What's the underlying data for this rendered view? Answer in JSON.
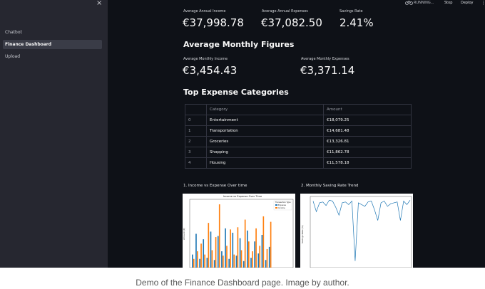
{
  "sidebar": {
    "close": "×",
    "items": [
      {
        "label": "Chatbot",
        "active": false
      },
      {
        "label": "Finance Dashboard",
        "active": true
      },
      {
        "label": "Upload",
        "active": false
      }
    ]
  },
  "topbar": {
    "running": "RUNNING...",
    "stop": "Stop",
    "deploy": "Deploy",
    "menu": "⋮"
  },
  "metrics_top": [
    {
      "label": "Average Annual Income",
      "value": "€37,998.78"
    },
    {
      "label": "Average Annual Expenses",
      "value": "€37,082.50"
    },
    {
      "label": "Savings Rate",
      "value": "2.41%"
    }
  ],
  "monthly": {
    "heading": "Average Monthly Figures",
    "items": [
      {
        "label": "Average Monthly Income",
        "value": "€3,454.43"
      },
      {
        "label": "Average Monthly Expenses",
        "value": "€3,371.14"
      }
    ]
  },
  "expenses": {
    "heading": "Top Expense Categories",
    "columns": [
      "Category",
      "Amount"
    ],
    "rows": [
      {
        "index": "0",
        "category": "Entertainment",
        "amount": "€18,079.25"
      },
      {
        "index": "1",
        "category": "Transportation",
        "amount": "€14,681.48"
      },
      {
        "index": "2",
        "category": "Groceries",
        "amount": "€13,326.81"
      },
      {
        "index": "3",
        "category": "Shopping",
        "amount": "€11,862.78"
      },
      {
        "index": "4",
        "category": "Housing",
        "amount": "€11,578.18"
      }
    ]
  },
  "charts": {
    "left_title": "1.     Income vs Expense Over time",
    "right_title": "2.     Monthly Saving Rate Trend",
    "left_plot_title": "Income vs Expense Over Time",
    "left_legend_header": "Transaction Type",
    "left_legend": [
      "Expense",
      "Income"
    ],
    "left_ylabel": "Amount (€)",
    "right_ylabel": "Savings Rate (%)",
    "expense_color": "#1f77b4",
    "income_color": "#ff7f0e",
    "line_color": "#1f77b4"
  },
  "chart_data": [
    {
      "type": "bar",
      "title": "Income vs Expense Over Time",
      "ylabel": "Amount (€)",
      "series": [
        {
          "name": "Expense",
          "values": [
            1200,
            3100,
            800,
            2600,
            900,
            3300,
            700,
            2900,
            1500,
            3600,
            800,
            3200,
            1100,
            2700,
            600,
            3400,
            900,
            2400,
            1300,
            3000,
            700,
            1900
          ]
        },
        {
          "name": "Income",
          "values": [
            800,
            1500,
            2200,
            1200,
            4100,
            1600,
            2800,
            5800,
            1100,
            2000,
            3500,
            1200,
            3700,
            1600,
            4400,
            2400,
            1500,
            3600,
            2000,
            4700,
            1700,
            4200
          ]
        }
      ]
    },
    {
      "type": "line",
      "ylabel": "Savings Rate (%)",
      "series": [
        {
          "name": "",
          "values": [
            -10,
            -70,
            -20,
            -15,
            -35,
            -5,
            -10,
            -45,
            -90,
            -20,
            -15,
            -30,
            -10,
            -350,
            -20,
            -30,
            -40,
            -15,
            -10,
            -60,
            -120,
            -20,
            -10,
            -40,
            -25,
            -20,
            -15,
            -120,
            -10,
            -30,
            -5
          ]
        }
      ]
    }
  ],
  "caption": "Demo of the Finance Dashboard page. Image by author."
}
